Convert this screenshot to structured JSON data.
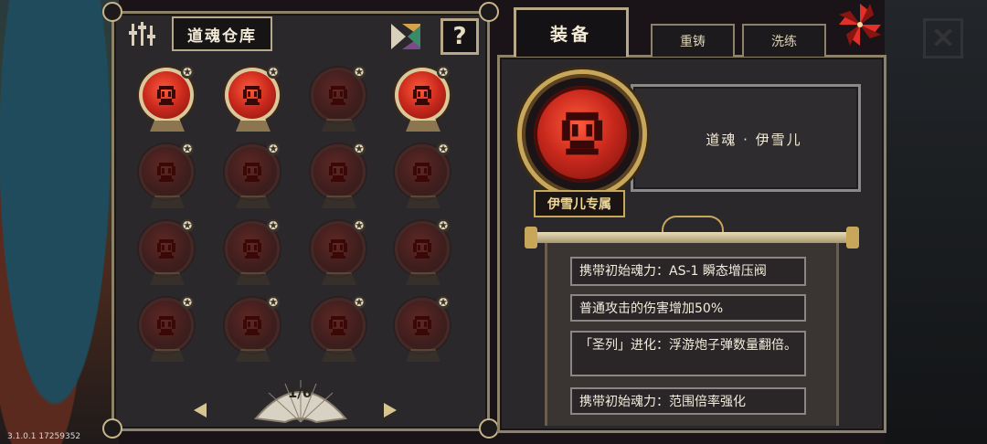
{
  "version": "3.1.0.1 17259352",
  "storage": {
    "title": "道魂仓库",
    "help_label": "?",
    "slots": [
      {
        "active": true
      },
      {
        "active": true
      },
      {
        "active": false
      },
      {
        "active": true
      },
      {
        "active": false
      },
      {
        "active": false
      },
      {
        "active": false
      },
      {
        "active": false
      },
      {
        "active": false
      },
      {
        "active": false
      },
      {
        "active": false
      },
      {
        "active": false
      },
      {
        "active": false
      },
      {
        "active": false
      },
      {
        "active": false
      },
      {
        "active": false
      }
    ],
    "star_glyph": "✪",
    "page": "1/6"
  },
  "tabs": {
    "equip": "装备",
    "reforge": "重铸",
    "refine": "洗练"
  },
  "detail": {
    "name": "道魂 · 伊雪儿",
    "exclusive": "伊雪儿专属",
    "effects": [
      "携带初始魂力：AS-1 瞬态增压阀",
      "普通攻击的伤害增加50%",
      "「圣列」进化：浮游炮子弹数量翻倍。",
      "携带初始魂力：范围倍率强化"
    ]
  },
  "colors": {
    "accent_gold": "#c8a65a",
    "orb_red": "#c8281c",
    "panel_bg": "#2b282c"
  }
}
